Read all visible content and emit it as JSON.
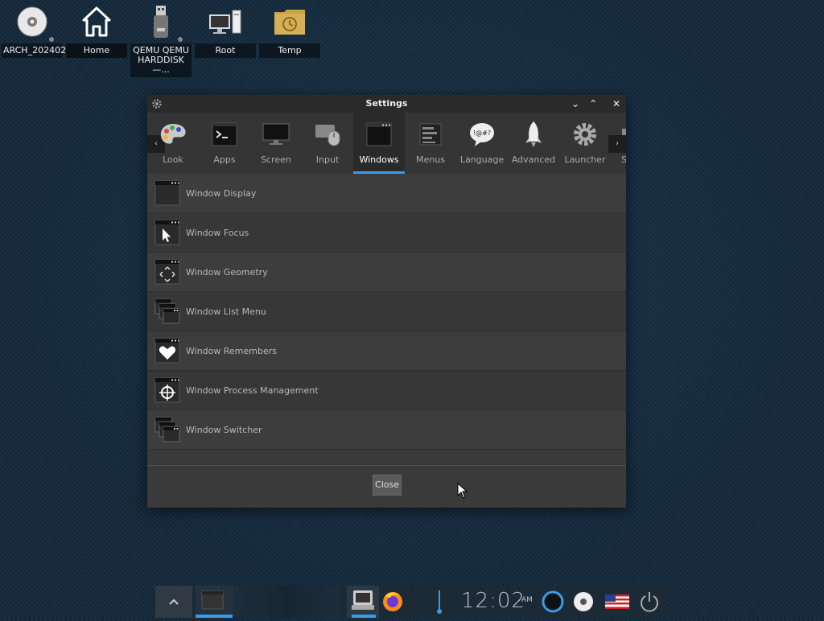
{
  "desktop": {
    "icons": [
      {
        "label": "ARCH_202402",
        "icon": "optical-disc-icon"
      },
      {
        "label": "Home",
        "icon": "home-icon"
      },
      {
        "label": "QEMU QEMU HARDDISK—...",
        "icon": "usb-drive-icon"
      },
      {
        "label": "Root",
        "icon": "computer-icon"
      },
      {
        "label": "Temp",
        "icon": "folder-clock-icon"
      }
    ]
  },
  "window": {
    "title": "Settings",
    "controls": {
      "minimize": "⌄",
      "maximize": "⌃",
      "close": "✕"
    },
    "toolbar": {
      "prev_arrow": "‹",
      "next_arrow": "›",
      "items": [
        {
          "label": "Look",
          "icon": "palette-icon"
        },
        {
          "label": "Apps",
          "icon": "terminal-icon"
        },
        {
          "label": "Screen",
          "icon": "monitor-icon"
        },
        {
          "label": "Input",
          "icon": "keyboard-mouse-icon"
        },
        {
          "label": "Windows",
          "icon": "window-icon",
          "active": true
        },
        {
          "label": "Menus",
          "icon": "menu-icon"
        },
        {
          "label": "Language",
          "icon": "speech-bubble-icon",
          "glyph": "!@#?"
        },
        {
          "label": "Advanced",
          "icon": "rocket-icon"
        },
        {
          "label": "Launcher",
          "icon": "gear-icon"
        },
        {
          "label": "S",
          "icon": "partial-icon"
        }
      ]
    },
    "list": [
      {
        "label": "Window Display",
        "icon": "window-display-icon"
      },
      {
        "label": "Window Focus",
        "icon": "window-focus-icon"
      },
      {
        "label": "Window Geometry",
        "icon": "window-geometry-icon"
      },
      {
        "label": "Window List Menu",
        "icon": "window-list-menu-icon"
      },
      {
        "label": "Window Remembers",
        "icon": "window-remembers-icon"
      },
      {
        "label": "Window Process Management",
        "icon": "window-process-icon"
      },
      {
        "label": "Window Switcher",
        "icon": "window-switcher-icon"
      }
    ],
    "close_button": "Close"
  },
  "taskbar": {
    "clock": {
      "time": "12:02",
      "ampm": "AM"
    },
    "accent_color": "#3a9be8"
  }
}
